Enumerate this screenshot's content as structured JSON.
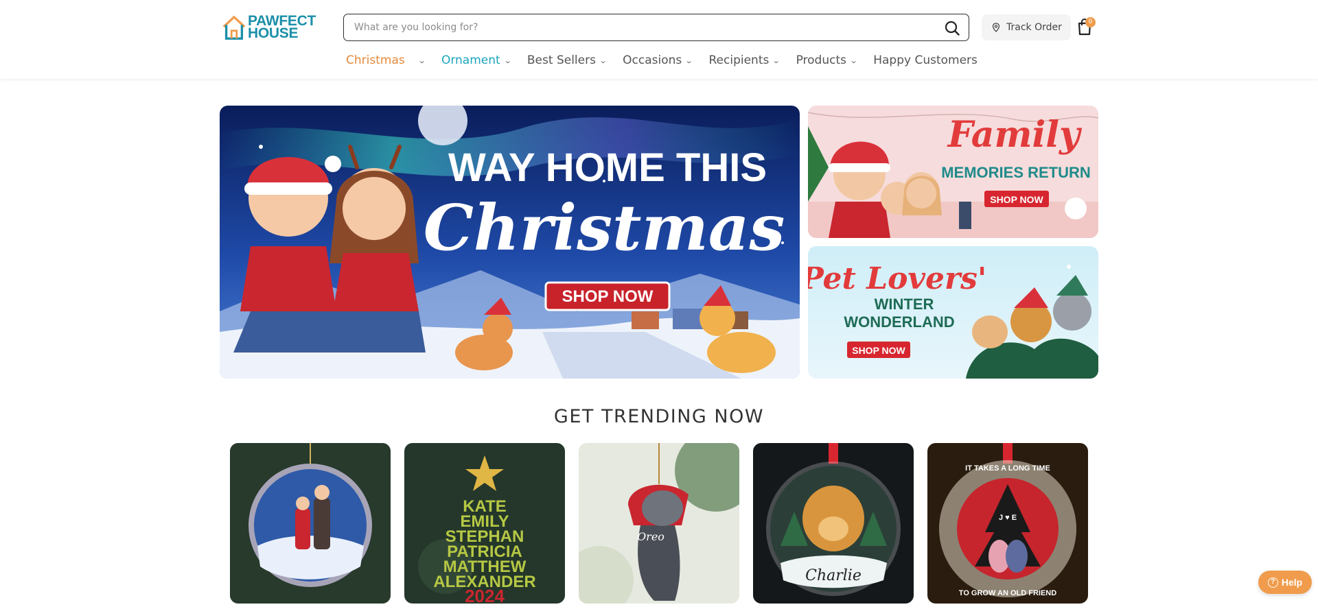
{
  "brand": {
    "line1": "PAWFECT",
    "line2": "HOUSE",
    "icon": "house-logo-icon"
  },
  "search": {
    "placeholder": "What are you looking for?",
    "value": ""
  },
  "header": {
    "track_order": "Track Order",
    "cart_count": "0"
  },
  "nav": [
    {
      "label": "Christmas",
      "has_dropdown": true
    },
    {
      "label": "Ornament",
      "has_dropdown": true
    },
    {
      "label": "Best Sellers",
      "has_dropdown": true
    },
    {
      "label": "Occasions",
      "has_dropdown": true
    },
    {
      "label": "Recipients",
      "has_dropdown": true
    },
    {
      "label": "Products",
      "has_dropdown": true
    },
    {
      "label": "Happy Customers",
      "has_dropdown": false
    }
  ],
  "hero": {
    "headline_1": "WAY HOME THIS",
    "headline_2": "Christmas",
    "cta": "SHOP NOW"
  },
  "side_banners": [
    {
      "title": "Family",
      "subtitle": "MEMORIES RETURN",
      "cta": "SHOP NOW"
    },
    {
      "title": "Pet Lovers'",
      "subtitle_1": "WINTER",
      "subtitle_2": "WONDERLAND",
      "cta": "SHOP NOW"
    }
  ],
  "trending": {
    "title": "GET TRENDING NOW",
    "products": [
      {
        "text": ""
      },
      {
        "names": [
          "KATE",
          "EMILY",
          "STEPHAN",
          "PATRICIA",
          "MATTHEW",
          "ALEXANDER"
        ],
        "year": "2024"
      },
      {
        "text": "Oreo"
      },
      {
        "text": "Charlie"
      },
      {
        "ring_top": "IT TAKES A LONG TIME",
        "ring_bottom": "TO GROW AN OLD FRIEND",
        "initials": "J ♥ E"
      }
    ]
  },
  "help": {
    "label": "Help"
  },
  "colors": {
    "accent": "#f09c4c",
    "christmas_nav": "#e58a3a",
    "ornament_nav": "#1aa5bd",
    "logo": "#1b8fa9"
  }
}
